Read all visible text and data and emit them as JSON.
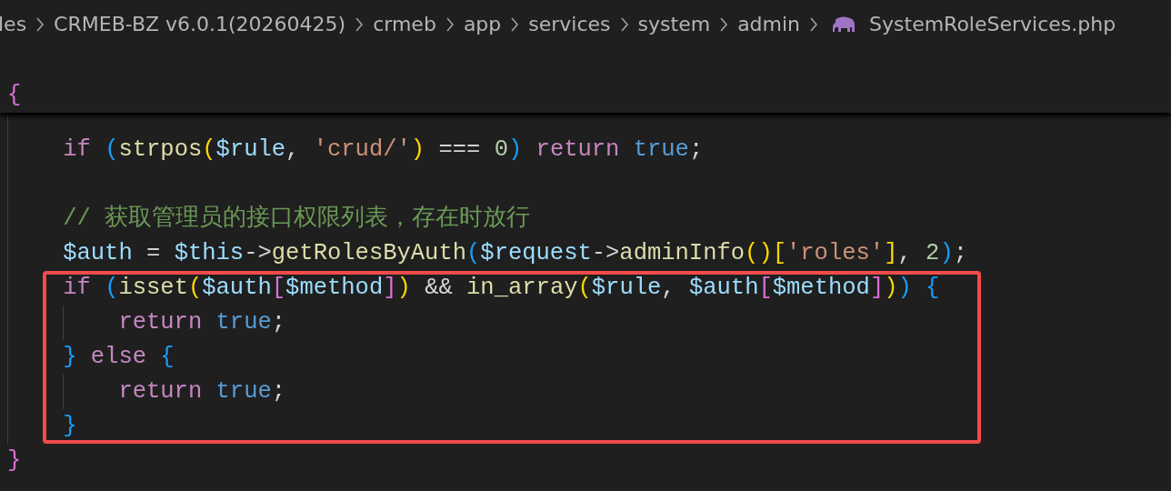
{
  "breadcrumbs": [
    {
      "kind": "folder",
      "text": "les"
    },
    {
      "kind": "folder",
      "text": "CRMEB-BZ v6.0.1(20260425)"
    },
    {
      "kind": "folder",
      "text": "crmeb"
    },
    {
      "kind": "folder",
      "text": "app"
    },
    {
      "kind": "folder",
      "text": "services"
    },
    {
      "kind": "folder",
      "text": "system"
    },
    {
      "kind": "folder",
      "text": "admin"
    },
    {
      "kind": "php",
      "text": "SystemRoleServices.php"
    }
  ],
  "sticky_scroll": {
    "tokens": [
      {
        "kind": "bracket2",
        "text": "{"
      }
    ]
  },
  "lines": [
    {
      "boxed": false,
      "tokens": [
        {
          "kind": "guide"
        }
      ]
    },
    {
      "boxed": false,
      "tokens": [
        {
          "kind": "guide"
        },
        {
          "kind": "keyword",
          "text": "if "
        },
        {
          "kind": "bracket3",
          "text": "("
        },
        {
          "kind": "function",
          "text": "strpos"
        },
        {
          "kind": "bracket1",
          "text": "("
        },
        {
          "kind": "variable",
          "text": "$rule"
        },
        {
          "kind": "plain",
          "text": ", "
        },
        {
          "kind": "string",
          "text": "'crud/'"
        },
        {
          "kind": "bracket1",
          "text": ")"
        },
        {
          "kind": "plain",
          "text": " === "
        },
        {
          "kind": "number",
          "text": "0"
        },
        {
          "kind": "bracket3",
          "text": ")"
        },
        {
          "kind": "keyword",
          "text": " return "
        },
        {
          "kind": "constant",
          "text": "true"
        },
        {
          "kind": "plain",
          "text": ";"
        }
      ]
    },
    {
      "boxed": false,
      "tokens": [
        {
          "kind": "guide"
        }
      ]
    },
    {
      "boxed": false,
      "tokens": [
        {
          "kind": "guide"
        },
        {
          "kind": "comment",
          "text": "// 获取管理员的接口权限列表，存在时放行"
        }
      ]
    },
    {
      "boxed": false,
      "tokens": [
        {
          "kind": "guide"
        },
        {
          "kind": "variable",
          "text": "$auth"
        },
        {
          "kind": "plain",
          "text": " = "
        },
        {
          "kind": "variable",
          "text": "$this"
        },
        {
          "kind": "plain",
          "text": "->"
        },
        {
          "kind": "function",
          "text": "getRolesByAuth"
        },
        {
          "kind": "bracket3",
          "text": "("
        },
        {
          "kind": "variable",
          "text": "$request"
        },
        {
          "kind": "plain",
          "text": "->"
        },
        {
          "kind": "function",
          "text": "adminInfo"
        },
        {
          "kind": "bracket1",
          "text": "()"
        },
        {
          "kind": "bracket1",
          "text": "["
        },
        {
          "kind": "string",
          "text": "'roles'"
        },
        {
          "kind": "bracket1",
          "text": "]"
        },
        {
          "kind": "plain",
          "text": ", "
        },
        {
          "kind": "number",
          "text": "2"
        },
        {
          "kind": "bracket3",
          "text": ")"
        },
        {
          "kind": "plain",
          "text": ";"
        }
      ]
    },
    {
      "boxed": true,
      "tokens": [
        {
          "kind": "guide"
        },
        {
          "kind": "keyword",
          "text": "if "
        },
        {
          "kind": "bracket3",
          "text": "("
        },
        {
          "kind": "function",
          "text": "isset"
        },
        {
          "kind": "bracket1",
          "text": "("
        },
        {
          "kind": "variable",
          "text": "$auth"
        },
        {
          "kind": "bracket2",
          "text": "["
        },
        {
          "kind": "variable",
          "text": "$method"
        },
        {
          "kind": "bracket2",
          "text": "]"
        },
        {
          "kind": "bracket1",
          "text": ")"
        },
        {
          "kind": "plain",
          "text": " && "
        },
        {
          "kind": "function",
          "text": "in_array"
        },
        {
          "kind": "bracket1",
          "text": "("
        },
        {
          "kind": "variable",
          "text": "$rule"
        },
        {
          "kind": "plain",
          "text": ", "
        },
        {
          "kind": "variable",
          "text": "$auth"
        },
        {
          "kind": "bracket2",
          "text": "["
        },
        {
          "kind": "variable",
          "text": "$method"
        },
        {
          "kind": "bracket2",
          "text": "]"
        },
        {
          "kind": "bracket1",
          "text": ")"
        },
        {
          "kind": "bracket3",
          "text": ") {"
        }
      ]
    },
    {
      "boxed": true,
      "tokens": [
        {
          "kind": "guide"
        },
        {
          "kind": "guide"
        },
        {
          "kind": "keyword",
          "text": "return "
        },
        {
          "kind": "constant",
          "text": "true"
        },
        {
          "kind": "plain",
          "text": ";"
        }
      ]
    },
    {
      "boxed": true,
      "tokens": [
        {
          "kind": "guide"
        },
        {
          "kind": "bracket3",
          "text": "} "
        },
        {
          "kind": "keyword",
          "text": "else "
        },
        {
          "kind": "bracket3",
          "text": "{"
        }
      ]
    },
    {
      "boxed": true,
      "tokens": [
        {
          "kind": "guide"
        },
        {
          "kind": "guide"
        },
        {
          "kind": "keyword",
          "text": "return "
        },
        {
          "kind": "constant",
          "text": "true"
        },
        {
          "kind": "plain",
          "text": ";"
        }
      ]
    },
    {
      "boxed": true,
      "tokens": [
        {
          "kind": "guide"
        },
        {
          "kind": "bracket3",
          "text": "}"
        }
      ]
    },
    {
      "boxed": false,
      "tokens": [
        {
          "kind": "bracket2",
          "text": "}"
        }
      ]
    }
  ]
}
